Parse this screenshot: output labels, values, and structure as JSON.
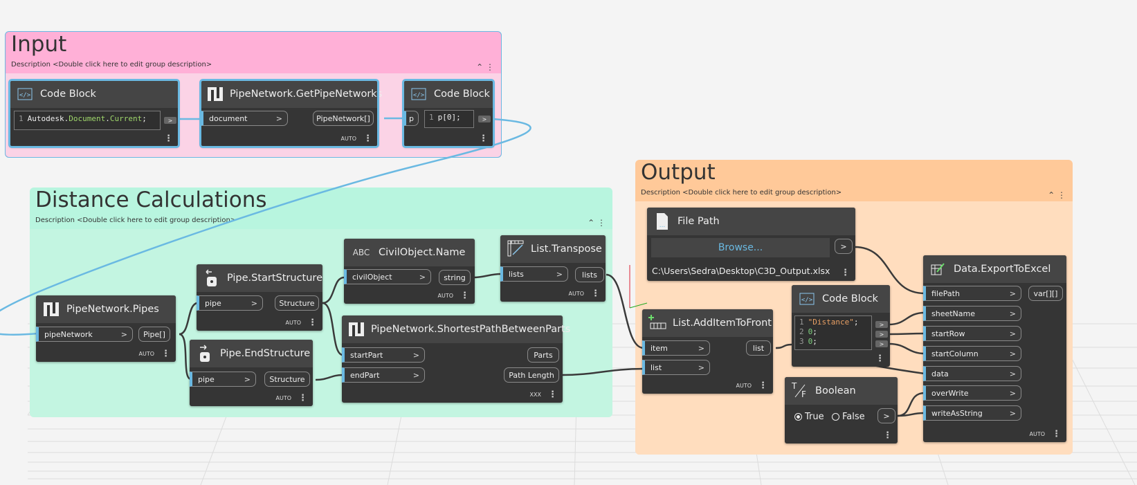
{
  "groups": {
    "input": {
      "title": "Input",
      "description": "Description <Double click here to edit group description>"
    },
    "distance": {
      "title": "Distance Calculations",
      "description": "Description <Double click here to edit group description>"
    },
    "output": {
      "title": "Output",
      "description": "Description <Double click here to edit group description>"
    }
  },
  "nodes": {
    "code_block_1": {
      "title": "Code Block",
      "line_no": "1",
      "code_a": "Autodesk.",
      "code_b": "Document",
      "code_c": ".",
      "code_d": "Current",
      "code_e": ";",
      "out": ">"
    },
    "get_pipe_networks": {
      "title": "PipeNetwork.GetPipeNetworks",
      "input": "document",
      "output": "PipeNetwork[]",
      "lacing": "AUTO"
    },
    "code_block_2": {
      "title": "Code Block",
      "input": "p",
      "line_no": "1",
      "code": "p[0];",
      "out": ">"
    },
    "pipes": {
      "title": "PipeNetwork.Pipes",
      "input": "pipeNetwork",
      "output": "Pipe[]",
      "lacing": "AUTO"
    },
    "start_structure": {
      "title": "Pipe.StartStructure",
      "input": "pipe",
      "output": "Structure",
      "lacing": "AUTO"
    },
    "end_structure": {
      "title": "Pipe.EndStructure",
      "input": "pipe",
      "output": "Structure",
      "lacing": "AUTO"
    },
    "civil_name": {
      "title": "CivilObject.Name",
      "icon_text": "ABC",
      "input": "civilObject",
      "output": "string",
      "lacing": "AUTO"
    },
    "transpose": {
      "title": "List.Transpose",
      "input": "lists",
      "output": "lists",
      "lacing": "AUTO"
    },
    "shortest_path": {
      "title": "PipeNetwork.ShortestPathBetweenParts",
      "input1": "startPart",
      "input2": "endPart",
      "output1": "Parts",
      "output2": "Path Length",
      "lacing": "XXX"
    },
    "file_path": {
      "title": "File Path",
      "browse": "Browse...",
      "path": "C:\\Users\\Sedra\\Desktop\\C3D_Output.xlsx",
      "out": ">"
    },
    "add_item_front": {
      "title": "List.AddItemToFront",
      "input1": "item",
      "input2": "list",
      "output": "list",
      "lacing": "AUTO"
    },
    "code_block_3": {
      "title": "Code Block",
      "lines": [
        {
          "n": "1",
          "text": "\"Distance\"",
          "end": ";"
        },
        {
          "n": "2",
          "text": "0",
          "end": ";"
        },
        {
          "n": "3",
          "text": "0",
          "end": ";"
        }
      ],
      "out": ">"
    },
    "boolean": {
      "title": "Boolean",
      "icon_t": "T",
      "icon_f": "F",
      "true_label": "True",
      "false_label": "False",
      "out": ">"
    },
    "export_excel": {
      "title": "Data.ExportToExcel",
      "inputs": [
        "filePath",
        "sheetName",
        "startRow",
        "startColumn",
        "data",
        "overWrite",
        "writeAsString"
      ],
      "output": "var[][]",
      "lacing": "AUTO"
    }
  },
  "colors": {
    "input_group": "#ffb0d7",
    "distance_group": "#b8f5df",
    "output_group": "#ffc999",
    "node_bg": "#353535",
    "wire": "#3a3a3a",
    "selected": "#6ab9e2"
  }
}
